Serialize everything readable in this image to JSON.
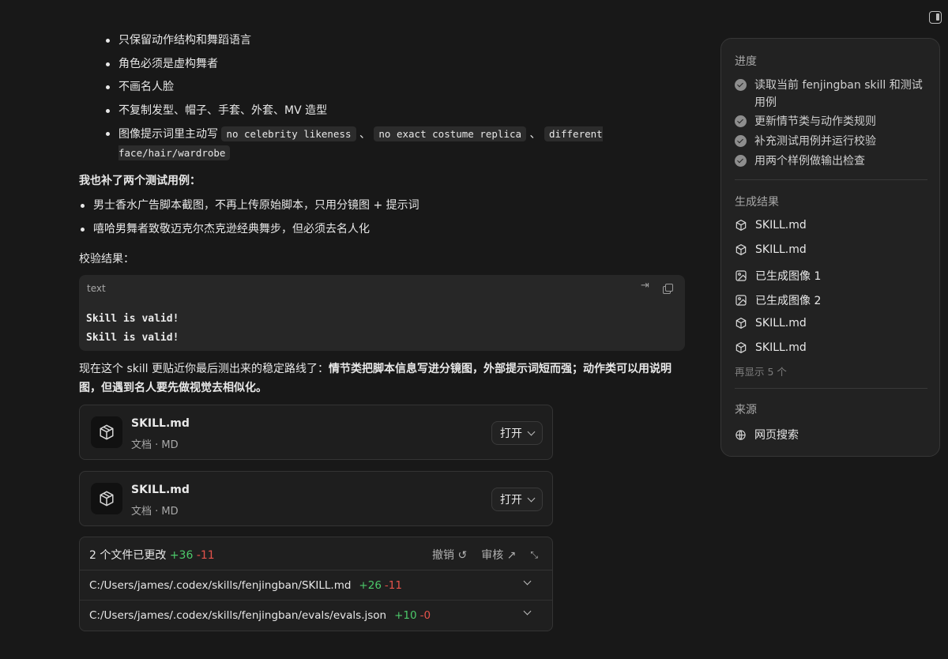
{
  "main": {
    "top_bullets": [
      "只保留动作结构和舞蹈语言",
      "角色必须是虚构舞者",
      "不画名人脸",
      "不复制发型、帽子、手套、外套、MV 造型"
    ],
    "prompt_bullet": {
      "prefix": "图像提示词里主动写",
      "code1": "no celebrity likeness",
      "sep1": "、",
      "code2": "no exact costume replica",
      "sep2": "、",
      "code3": "different face/hair/wardrobe"
    },
    "test_intro": "我也补了两个测试用例：",
    "test_bullets": [
      "男士香水广告脚本截图，不再上传原始脚本，只用分镜图 + 提示词",
      "嘻哈男舞者致敬迈克尔杰克逊经典舞步，但必须去名人化"
    ],
    "validate_label": "校验结果：",
    "codeblock": {
      "lang": "text",
      "lines": "Skill is valid!\nSkill is valid!"
    },
    "summary_plain": "现在这个 skill 更贴近你最后测出来的稳定路线了：",
    "summary_bold": "情节类把脚本信息写进分镜图，外部提示词短而强；动作类可以用说明图，但遇到名人要先做视觉去相似化。",
    "files": [
      {
        "name": "SKILL.md",
        "meta": "文档 · MD",
        "open_label": "打开"
      },
      {
        "name": "SKILL.md",
        "meta": "文档 · MD",
        "open_label": "打开"
      }
    ],
    "diff": {
      "title": "2 个文件已更改",
      "added": "+36",
      "removed": "-11",
      "undo_label": "撤销",
      "review_label": "审核",
      "rows": [
        {
          "path": "C:/Users/james/.codex/skills/fenjingban/SKILL.md",
          "added": "+26",
          "removed": "-11"
        },
        {
          "path": "C:/Users/james/.codex/skills/fenjingban/evals/evals.json",
          "added": "+10",
          "removed": "-0"
        }
      ]
    }
  },
  "side": {
    "progress_title": "进度",
    "steps": [
      "读取当前 fenjingban skill 和测试用例",
      "更新情节类与动作类规则",
      "补充测试用例并运行校验",
      "用两个样例做输出检查"
    ],
    "results_title": "生成结果",
    "results": [
      {
        "label": "SKILL.md",
        "icon": "cube-icon"
      },
      {
        "label": "SKILL.md",
        "icon": "cube-icon"
      },
      {
        "label": "已生成图像 1",
        "icon": "image-icon"
      },
      {
        "label": "已生成图像 2",
        "icon": "image-icon"
      },
      {
        "label": "SKILL.md",
        "icon": "cube-icon"
      },
      {
        "label": "SKILL.md",
        "icon": "cube-icon"
      }
    ],
    "more_label": "再显示 5 个",
    "sources_title": "来源",
    "source_item": "网页搜索"
  }
}
